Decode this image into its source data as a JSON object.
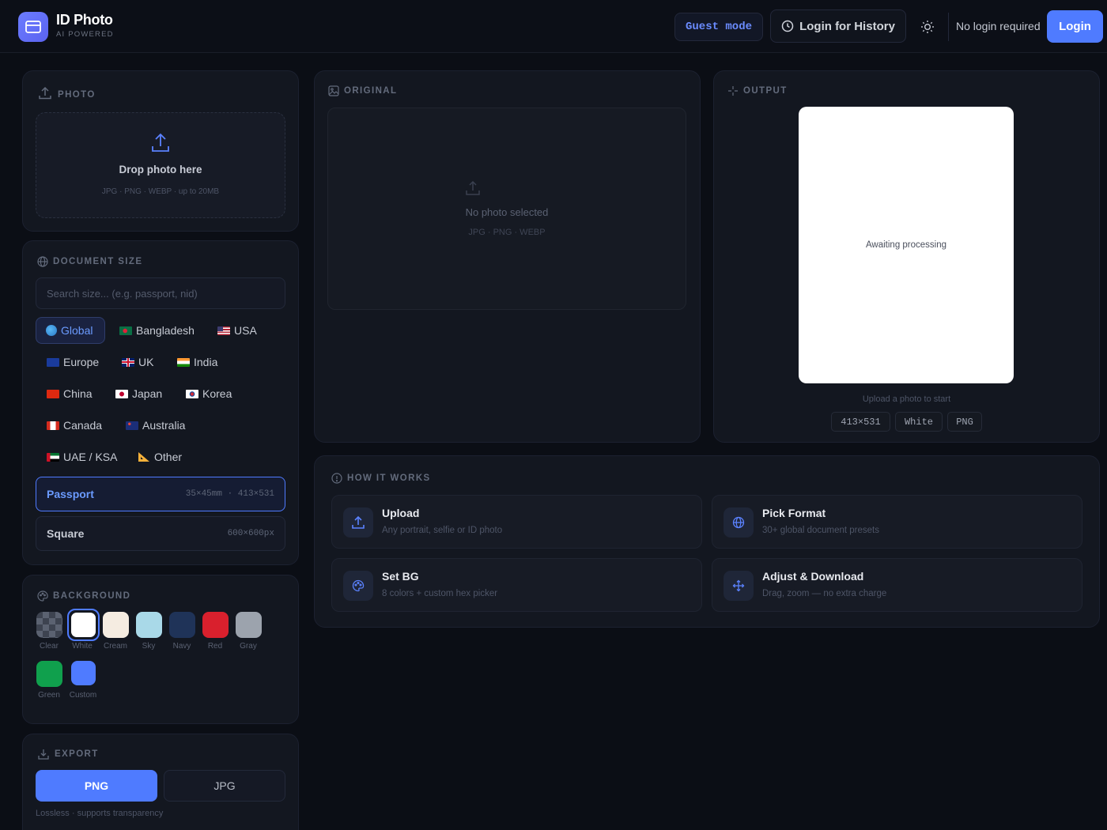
{
  "header": {
    "title": "ID Photo",
    "subtitle": "AI POWERED",
    "guest_label": "Guest mode",
    "history_label": "Login for History",
    "no_login_text": "No login required",
    "login_label": "Login"
  },
  "photo": {
    "section_title": "PHOTO",
    "drop_title": "Drop photo here",
    "drop_sub": "JPG · PNG · WEBP · up to 20MB"
  },
  "document_size": {
    "section_title": "DOCUMENT SIZE",
    "search_placeholder": "Search size... (e.g. passport, nid)",
    "regions": [
      "Global",
      "Bangladesh",
      "USA",
      "Europe",
      "UK",
      "India",
      "China",
      "Japan",
      "Korea",
      "Canada",
      "Australia",
      "UAE / KSA",
      "Other"
    ],
    "active_region": "Global",
    "presets": [
      {
        "name": "Passport",
        "dims": "35×45mm · 413×531",
        "active": true
      },
      {
        "name": "Square",
        "dims": "600×600px",
        "active": false
      }
    ]
  },
  "background": {
    "section_title": "BACKGROUND",
    "selected": "White",
    "swatches": [
      {
        "label": "Clear",
        "color": "checker"
      },
      {
        "label": "White",
        "color": "#ffffff"
      },
      {
        "label": "Cream",
        "color": "#f5ece1"
      },
      {
        "label": "Sky",
        "color": "#a9d9e8"
      },
      {
        "label": "Navy",
        "color": "#1f3358"
      },
      {
        "label": "Red",
        "color": "#d9202d"
      },
      {
        "label": "Gray",
        "color": "#9ca3ad"
      },
      {
        "label": "Green",
        "color": "#10a04d"
      },
      {
        "label": "Custom",
        "color": "#4f7bff"
      }
    ]
  },
  "export": {
    "section_title": "EXPORT",
    "png_label": "PNG",
    "jpg_label": "JPG",
    "selected": "PNG",
    "note": "Lossless · supports transparency"
  },
  "original": {
    "section_title": "ORIGINAL",
    "empty_title": "No photo selected",
    "empty_sub": "JPG · PNG · WEBP"
  },
  "output": {
    "section_title": "OUTPUT",
    "frame_text": "Awaiting processing",
    "hint": "Upload a photo to start",
    "tags": [
      "413×531",
      "White",
      "PNG"
    ]
  },
  "how_it_works": {
    "section_title": "HOW IT WORKS",
    "steps": [
      {
        "title": "Upload",
        "desc": "Any portrait, selfie or ID photo",
        "icon": "upload-icon"
      },
      {
        "title": "Pick Format",
        "desc": "30+ global document presets",
        "icon": "globe-icon"
      },
      {
        "title": "Set BG",
        "desc": "8 colors + custom hex picker",
        "icon": "palette-icon"
      },
      {
        "title": "Adjust & Download",
        "desc": "Drag, zoom — no extra charge",
        "icon": "move-icon"
      }
    ]
  },
  "colors": {
    "accent": "#4f7bff",
    "background": "#0b0e15",
    "card": "#131720"
  }
}
